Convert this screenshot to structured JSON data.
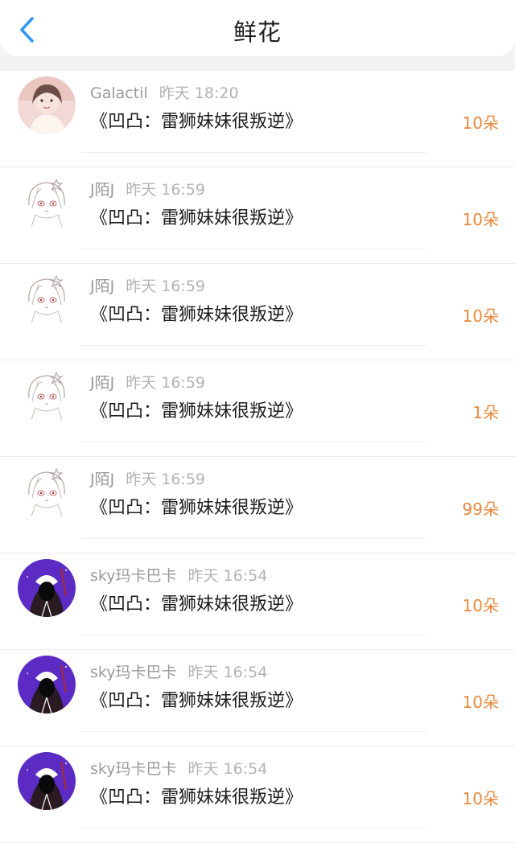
{
  "header": {
    "title": "鲜花"
  },
  "colors": {
    "accent_blue": "#2f97f2",
    "amount_orange": "#e8893e"
  },
  "records": [
    {
      "user": "Galactil",
      "time": "昨天 18:20",
      "book": "《凹凸：雷狮妹妹很叛逆》",
      "amount": "10朵",
      "avatar": "photo-avatar"
    },
    {
      "user": "J陌J",
      "time": "昨天 16:59",
      "book": "《凹凸：雷狮妹妹很叛逆》",
      "amount": "10朵",
      "avatar": "sketch-avatar"
    },
    {
      "user": "J陌J",
      "time": "昨天 16:59",
      "book": "《凹凸：雷狮妹妹很叛逆》",
      "amount": "10朵",
      "avatar": "sketch-avatar"
    },
    {
      "user": "J陌J",
      "time": "昨天 16:59",
      "book": "《凹凸：雷狮妹妹很叛逆》",
      "amount": "1朵",
      "avatar": "sketch-avatar"
    },
    {
      "user": "J陌J",
      "time": "昨天 16:59",
      "book": "《凹凸：雷狮妹妹很叛逆》",
      "amount": "99朵",
      "avatar": "sketch-avatar"
    },
    {
      "user": "sky玛卡巴卡",
      "time": "昨天 16:54",
      "book": "《凹凸：雷狮妹妹很叛逆》",
      "amount": "10朵",
      "avatar": "purple-avatar"
    },
    {
      "user": "sky玛卡巴卡",
      "time": "昨天 16:54",
      "book": "《凹凸：雷狮妹妹很叛逆》",
      "amount": "10朵",
      "avatar": "purple-avatar"
    },
    {
      "user": "sky玛卡巴卡",
      "time": "昨天 16:54",
      "book": "《凹凸：雷狮妹妹很叛逆》",
      "amount": "10朵",
      "avatar": "purple-avatar"
    }
  ]
}
